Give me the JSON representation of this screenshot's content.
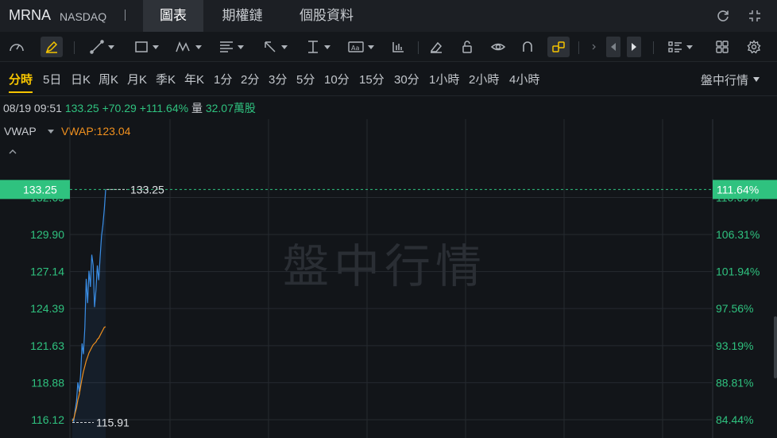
{
  "header": {
    "ticker": "MRNA",
    "exchange": "NASDAQ",
    "tabs": [
      {
        "label": "圖表",
        "active": true
      },
      {
        "label": "期權鏈",
        "active": false
      },
      {
        "label": "個股資料",
        "active": false
      }
    ],
    "icons": [
      "refresh-icon",
      "fullscreen-icon"
    ]
  },
  "toolbar": {
    "icons": [
      "gauge-icon",
      "pen-icon",
      "line-tool-icon",
      "rectangle-tool-icon",
      "pattern-tool-icon",
      "fibonacci-tool-icon",
      "arrow-tool-icon",
      "measure-tool-icon",
      "text-tool-icon",
      "indicator-icon",
      "eraser-icon",
      "unlock-icon",
      "eye-icon",
      "magnet-icon",
      "link-icon",
      "step-back-icon",
      "step-forward-icon",
      "layout-icon",
      "grid-icon",
      "settings-icon"
    ]
  },
  "periods": {
    "items": [
      "分時",
      "5日",
      "日K",
      "周K",
      "月K",
      "季K",
      "年K",
      "1分",
      "2分",
      "3分",
      "5分",
      "10分",
      "15分",
      "30分",
      "1小時",
      "2小時",
      "4小時"
    ],
    "active": "分時",
    "session": "盤中行情"
  },
  "info": {
    "datetime": "08/19 09:51",
    "price": "133.25",
    "change": "+70.29",
    "change_pct": "+111.64%",
    "volume_label": "量",
    "volume": "32.07萬股"
  },
  "vwap": {
    "name": "VWAP",
    "value_text": "VWAP:123.04"
  },
  "colors": {
    "up": "#2fc27f",
    "price_line": "#3a8ee6",
    "vwap_line": "#f0901e",
    "accent": "#f5c400"
  },
  "chart_data": {
    "type": "line",
    "watermark": "盤中行情",
    "y_ticks_left": [
      "132.65",
      "129.90",
      "127.14",
      "124.39",
      "121.63",
      "118.88",
      "116.12"
    ],
    "y_ticks_right": [
      "110.69%",
      "106.31%",
      "101.94%",
      "97.56%",
      "93.19%",
      "88.81%",
      "84.44%"
    ],
    "ylim": [
      115.2,
      135.0
    ],
    "current_price_label": "133.25",
    "current_pct_label": "111.64%",
    "high_label": "133.25",
    "low_label": "115.91",
    "series": [
      {
        "values": [
          116.2,
          116.0,
          116.8,
          117.5,
          118.9,
          118.2,
          119.5,
          121.8,
          121.0,
          123.0,
          126.6,
          124.8,
          127.2,
          126.0,
          128.4,
          127.6,
          124.5,
          125.8,
          127.6,
          126.5,
          128.2,
          129.8,
          130.6,
          131.8,
          133.25
        ]
      },
      {
        "values": [
          116.0,
          116.2,
          116.6,
          117.0,
          117.6,
          118.0,
          118.6,
          119.2,
          119.7,
          120.1,
          120.5,
          120.8,
          121.1,
          121.3,
          121.5,
          121.7,
          121.8,
          121.9,
          122.1,
          122.2,
          122.4,
          122.6,
          122.8,
          123.0,
          123.04
        ]
      }
    ]
  }
}
